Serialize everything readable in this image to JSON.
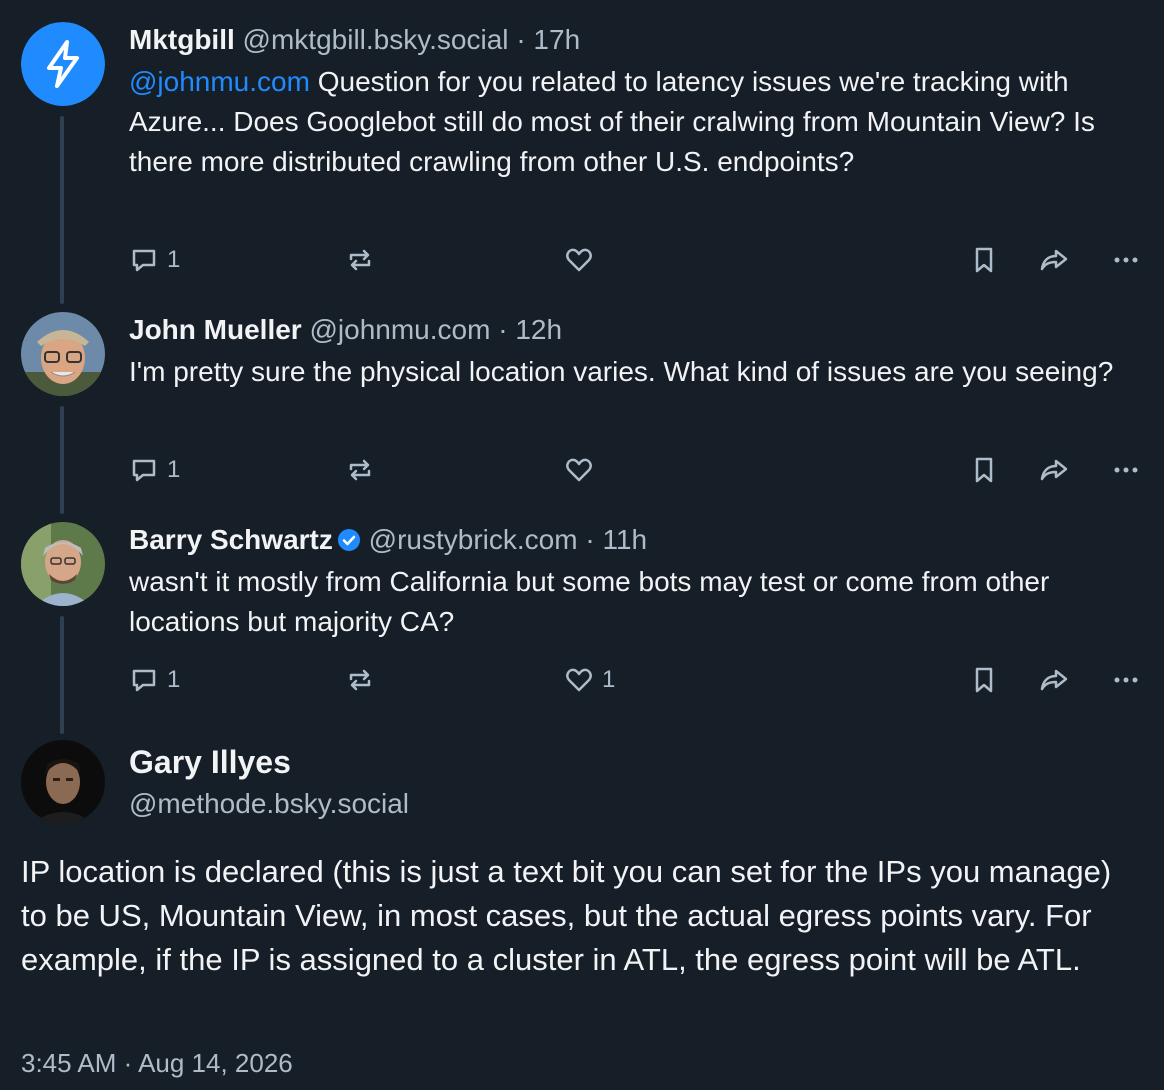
{
  "colors": {
    "background": "#161e27",
    "thread_line": "#2e4052",
    "muted": "#aebbc9",
    "mention": "#208bfe",
    "verified": "#208bfe"
  },
  "posts": [
    {
      "author": "Mktgbill",
      "handle": "@mktgbill.bsky.social",
      "separator": "·",
      "time": "17h",
      "mention": "@johnmu.com",
      "text": " Question for you related to latency issues we're tracking with Azure... Does Googlebot still do most of their cralwing from Mountain View?  Is there more distributed crawling from other U.S. endpoints?",
      "reply_count": "1",
      "repost_count": "",
      "like_count": ""
    },
    {
      "author": "John Mueller",
      "handle": "@johnmu.com",
      "separator": "·",
      "time": "12h",
      "text": "I'm pretty sure the physical location varies. What kind of issues are you seeing?",
      "reply_count": "1",
      "repost_count": "",
      "like_count": ""
    },
    {
      "author": "Barry Schwartz",
      "handle": "@rustybrick.com",
      "separator": "·",
      "time": "11h",
      "text": "wasn't it mostly from California but some bots may test or come from other locations but majority CA?",
      "reply_count": "1",
      "repost_count": "",
      "like_count": "1"
    }
  ],
  "main_post": {
    "author": "Gary Illyes",
    "handle": "@methode.bsky.social",
    "text": "IP location is declared (this is just a text bit you can set for the IPs you manage) to be US, Mountain View, in most cases, but the actual egress points vary. For example, if the IP is assigned to a cluster in ATL, the egress point will be ATL.",
    "timestamp": "3:45 AM · Aug 14, 2026"
  }
}
